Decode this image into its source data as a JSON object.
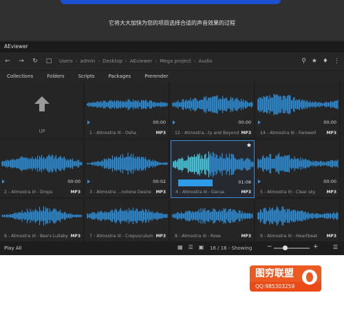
{
  "banner": {
    "text": "它将大大加快为您的项目选择合适的声音效果的过程"
  },
  "window": {
    "title": "AEviewer"
  },
  "breadcrumb": [
    "Users",
    "admin",
    "Desktop",
    "AEviewer",
    "Mega project",
    "Audio"
  ],
  "tabs": [
    "Collections",
    "Folders",
    "Scripts",
    "Packages",
    "Prerender"
  ],
  "up_label": "UP",
  "tiles": [
    {
      "name": "1 - Atmostra III - Osha",
      "duration": "00:00",
      "format": "MP3"
    },
    {
      "name": "12 - Atmostra...ty and Beyond",
      "duration": "00:00",
      "format": "MP3"
    },
    {
      "name": "14 - Atmostra III - Farewell",
      "duration": "00:00",
      "format": "MP3"
    },
    {
      "name": "2 - Atmostra III - Drops",
      "duration": "00:00",
      "format": "MP3"
    },
    {
      "name": "3 - Atmostra ...notone Desire",
      "duration": "00:02",
      "format": "MP3"
    },
    {
      "name": "4 - Atmostra III - Garua",
      "duration": "01:08",
      "format": "MP3"
    },
    {
      "name": "5 - Atmostra III - Clear sky",
      "duration": "00:00",
      "format": "MP3"
    },
    {
      "name": "6 - Atmostra III - Bee's Lullaby",
      "duration": "",
      "format": "MP3"
    },
    {
      "name": "7 - Atmostra III - Crepusculum",
      "duration": "",
      "format": "MP3"
    },
    {
      "name": "8 - Atmostra III - Rose",
      "duration": "",
      "format": "MP3"
    },
    {
      "name": "9 - Atmostra III - Heartbeat",
      "duration": "",
      "format": "MP3"
    }
  ],
  "status": {
    "play_all": "Play All",
    "count": "16 / 16 - Showing"
  },
  "logo": {
    "title": "图穷联盟",
    "qq": "QQ:985303259"
  },
  "colors": {
    "accent": "#3a8fd8",
    "wave": "#2f8fd8",
    "logo": "#ec5a23"
  }
}
